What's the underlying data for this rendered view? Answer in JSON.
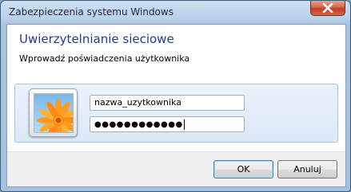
{
  "window": {
    "title": "Zabezpieczenia systemu Windows",
    "close_icon": "close-icon"
  },
  "dialog": {
    "heading": "Uwierzytelnianie sieciowe",
    "subheading": "Wprowadź poświadczenia użytkownika"
  },
  "credentials": {
    "avatar_icon": "flower-avatar-icon",
    "username_value": "nazwa_uzytkownika",
    "password_value": "●●●●●●●●●●●●"
  },
  "buttons": {
    "ok_label": "OK",
    "cancel_label": "Anuluj"
  },
  "colors": {
    "heading": "#1e3c96",
    "close_button": "#c23a1f",
    "frame": "#a4c0e0"
  }
}
